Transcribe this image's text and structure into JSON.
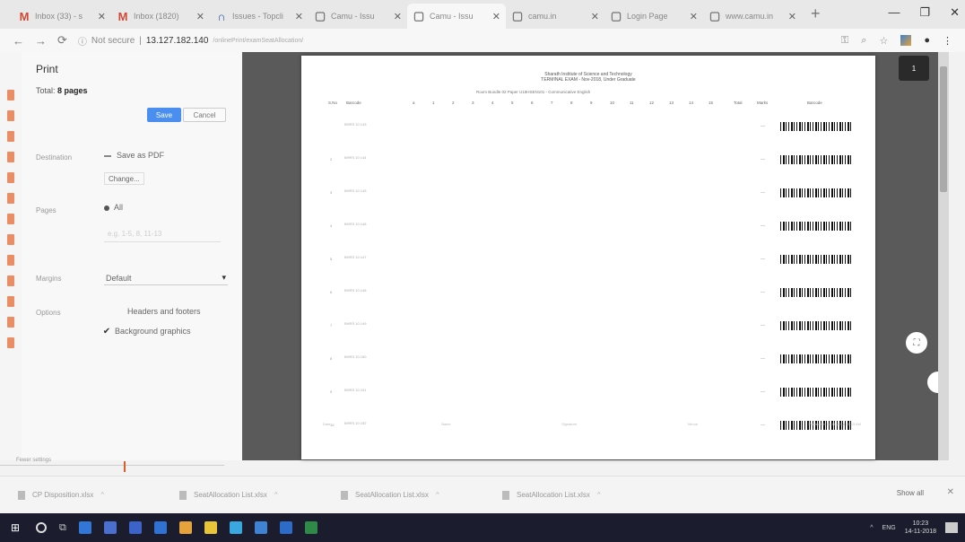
{
  "browser": {
    "tabs": [
      {
        "icon": "M",
        "icon_color": "#d14836",
        "label": "Inbox (33) - s",
        "active": false
      },
      {
        "icon": "M",
        "icon_color": "#d14836",
        "label": "Inbox (1820)",
        "active": false
      },
      {
        "icon": "∩",
        "icon_color": "#2a5caa",
        "label": "Issues - Topcli",
        "active": false
      },
      {
        "icon": "▢",
        "icon_color": "#777",
        "label": "Camu - Issu",
        "active": false
      },
      {
        "icon": "▢",
        "icon_color": "#777",
        "label": "Camu - Issu",
        "active": true
      },
      {
        "icon": "▢",
        "icon_color": "#777",
        "label": "camu.in",
        "active": false
      },
      {
        "icon": "▢",
        "icon_color": "#777",
        "label": "Login Page",
        "active": false
      },
      {
        "icon": "▢",
        "icon_color": "#777",
        "label": "www.camu.in",
        "active": false
      }
    ],
    "new_tab": "+",
    "window_controls": [
      "—",
      "❐",
      "✕"
    ],
    "address": {
      "security": "Not secure",
      "host": "13.127.182.140",
      "path": "/onlinePrint/examSeatAllocation/"
    }
  },
  "print_panel": {
    "title": "Print",
    "total_label": "Total: ",
    "total_value": "8 pages",
    "save_label": "Save",
    "cancel_label": "Cancel",
    "destination_label": "Destination",
    "destination_value": "Save as PDF",
    "change_label": "Change...",
    "pages_label": "Pages",
    "pages_value": "All",
    "pages_placeholder": "e.g. 1-5, 8, 11-13",
    "margins_label": "Margins",
    "margins_value": "Default",
    "options_label": "Options",
    "option_headers": "Headers and footers",
    "option_background": "Background graphics",
    "option_background_checked": true,
    "footer_note": "Fewer settings"
  },
  "document": {
    "heading_1": "Sharath Institute of Science and Technology",
    "heading_2": "TERMINAL EXAM - Nov-2018, Under Graduate",
    "sub_line": "Room        Bundle   02      Paper   U18HSEN101 - Communicative English",
    "col_sno": "S.No",
    "col_barcode_l": "Barcode",
    "col_total": "Total",
    "col_marks": "Marks",
    "col_barcode_r": "Barcode",
    "question_cols": [
      "a",
      "1",
      "2",
      "3",
      "4",
      "5",
      "6",
      "7",
      "8",
      "9",
      "10",
      "11",
      "12",
      "13",
      "14",
      "15"
    ],
    "rows": [
      {
        "sno": "",
        "code": "BHRS 10 143"
      },
      {
        "sno": "2",
        "code": "BHRS 10 144"
      },
      {
        "sno": "3",
        "code": "BHRS 10 145"
      },
      {
        "sno": "4",
        "code": "BHRS 10 146"
      },
      {
        "sno": "5",
        "code": "BHRS 10 147"
      },
      {
        "sno": "6",
        "code": "BHRS 10 148"
      },
      {
        "sno": "7",
        "code": "BHRS 10 149"
      },
      {
        "sno": "8",
        "code": "BHRS 10 150"
      },
      {
        "sno": "9",
        "code": "BHRS 10 151"
      },
      {
        "sno": "10",
        "code": "BHRS 10 152"
      }
    ],
    "footer": [
      "Date",
      "Name",
      "Signature",
      "Venue",
      "Printed On 14-11-2018 10:23 AM"
    ],
    "page_badge": "1"
  },
  "downloads": {
    "items": [
      {
        "label": "CP Disposition.xlsx"
      },
      {
        "label": "SeatAllocation List.xlsx"
      },
      {
        "label": "SeatAllocation List.xlsx"
      },
      {
        "label": "SeatAllocation List.xlsx"
      }
    ],
    "show_all": "Show all",
    "close": "✕"
  },
  "taskbar": {
    "apps": [
      {
        "name": "edge-icon",
        "color": "#3277d6"
      },
      {
        "name": "folder-icon",
        "color": "#4a6fcf"
      },
      {
        "name": "store-icon",
        "color": "#3b63c9"
      },
      {
        "name": "mail-icon",
        "color": "#2f72d4"
      },
      {
        "name": "chrome-icon",
        "color": "#e6a23b"
      },
      {
        "name": "files-icon",
        "color": "#e8c43a"
      },
      {
        "name": "skype-icon",
        "color": "#3aa7e0"
      },
      {
        "name": "app-icon",
        "color": "#3f82d3"
      },
      {
        "name": "outlook-icon",
        "color": "#2d6bc9"
      },
      {
        "name": "excel-icon",
        "color": "#2f8a4a"
      }
    ],
    "lang": "ENG",
    "time": "10:23",
    "date": "14-11-2018"
  }
}
